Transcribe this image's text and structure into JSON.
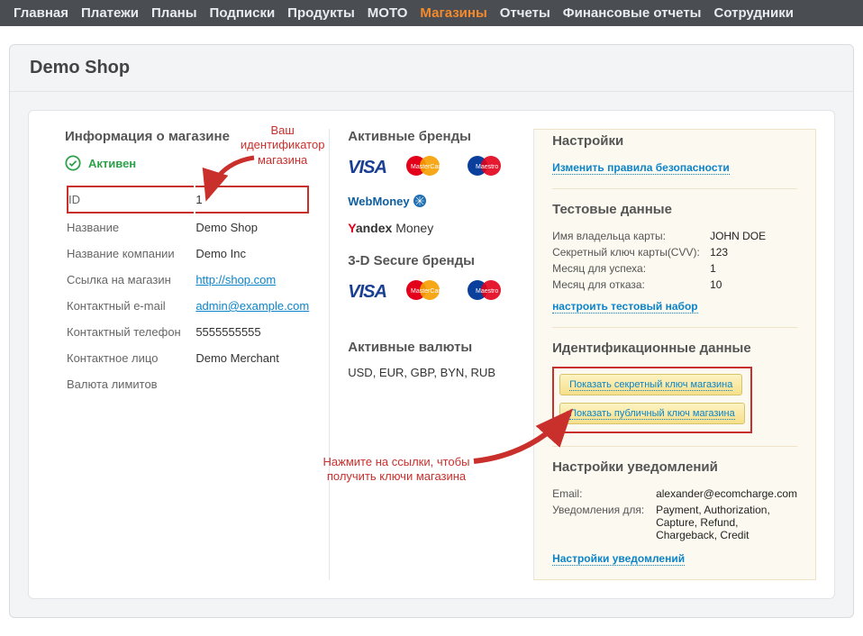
{
  "nav": {
    "items": [
      {
        "label": "Главная"
      },
      {
        "label": "Платежи"
      },
      {
        "label": "Планы"
      },
      {
        "label": "Подписки"
      },
      {
        "label": "Продукты"
      },
      {
        "label": "МОТО"
      },
      {
        "label": "Магазины",
        "active": true
      },
      {
        "label": "Отчеты"
      },
      {
        "label": "Финансовые отчеты"
      },
      {
        "label": "Сотрудники"
      }
    ]
  },
  "page_title": "Demo Shop",
  "shop": {
    "heading": "Информация о магазине",
    "status": "Активен",
    "rows": {
      "id_label": "ID",
      "id_value": "1",
      "name_label": "Название",
      "name_value": "Demo Shop",
      "company_label": "Название компании",
      "company_value": "Demo Inc",
      "url_label": "Ссылка на магазин",
      "url_value": "http://shop.com",
      "email_label": "Контактный e-mail",
      "email_value": "admin@example.com",
      "phone_label": "Контактный телефон",
      "phone_value": "5555555555",
      "contact_label": "Контактное лицо",
      "contact_value": "Demo Merchant",
      "limit_label": "Валюта лимитов"
    }
  },
  "brands": {
    "active_heading": "Активные бренды",
    "threed_heading": "3-D Secure бренды",
    "currency_heading": "Активные валюты",
    "currencies": "USD, EUR, GBP, BYN, RUB",
    "logos": {
      "visa": "VISA",
      "mc": "MasterCard",
      "maestro": "Maestro",
      "wm": "WebMoney",
      "ym": "Yandex Money"
    }
  },
  "settings": {
    "heading": "Настройки",
    "security_link": "Изменить правила безопасности"
  },
  "testdata": {
    "heading": "Тестовые данные",
    "rows": {
      "owner_k": "Имя владельца карты:",
      "owner_v": "JOHN DOE",
      "cvv_k": "Секретный ключ карты(CVV):",
      "cvv_v": "123",
      "success_k": "Месяц для успеха:",
      "success_v": "1",
      "fail_k": "Месяц для отказа:",
      "fail_v": "10"
    },
    "configure_link": "настроить тестовый набор"
  },
  "creds": {
    "heading": "Идентификационные данные",
    "show_secret": "Показать секретный ключ магазина",
    "show_public": "Показать публичный ключ магазина"
  },
  "notif": {
    "heading": "Настройки уведомлений",
    "email_k": "Email:",
    "email_v": "alexander@ecomcharge.com",
    "for_k": "Уведомления для:",
    "for_v": "Payment, Authorization, Capture, Refund, Chargeback, Credit",
    "link": "Настройки уведомлений"
  },
  "annotations": {
    "id_hint": "Ваш идентификатор магазина",
    "keys_hint": "Нажмите на ссылки, чтобы получить ключи магазина"
  }
}
